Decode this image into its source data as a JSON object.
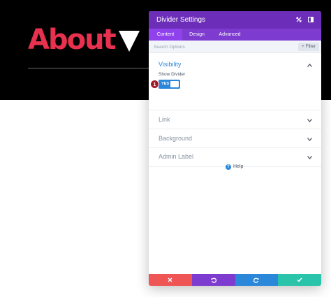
{
  "hero": {
    "title": "About"
  },
  "panel": {
    "title": "Divider Settings",
    "tabs": [
      {
        "label": "Content",
        "active": true
      },
      {
        "label": "Design",
        "active": false
      },
      {
        "label": "Advanced",
        "active": false
      }
    ],
    "search": {
      "placeholder": "Search Options",
      "filter_label": "+ Filter"
    },
    "sections": [
      {
        "title": "Visibility",
        "expanded": true
      },
      {
        "title": "Link",
        "expanded": false
      },
      {
        "title": "Background",
        "expanded": false
      },
      {
        "title": "Admin Label",
        "expanded": false
      }
    ],
    "visibility": {
      "field_label": "Show Divider",
      "toggle_value": "YES",
      "step_badge": "1"
    },
    "help_label": "Help",
    "footer": {
      "buttons": [
        {
          "icon": "close-icon",
          "color": "#ef5555"
        },
        {
          "icon": "undo-icon",
          "color": "#7e3bd0"
        },
        {
          "icon": "redo-icon",
          "color": "#2b87da"
        },
        {
          "icon": "check-icon",
          "color": "#29c4a9"
        }
      ]
    }
  },
  "colors": {
    "hero_title": "#e8314e",
    "panel_header": "#6c2eb9",
    "tabs_bar": "#7e3bd0",
    "accent_blue": "#2b87da",
    "badge": "#a01c2a"
  }
}
